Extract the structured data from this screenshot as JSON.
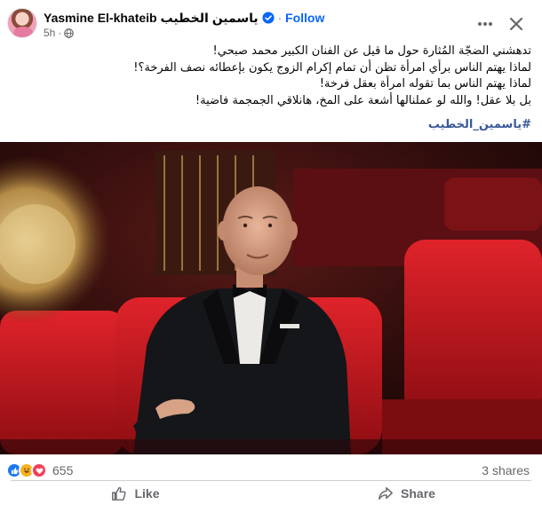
{
  "header": {
    "author_name": "Yasmine El-khateib ياسمين الخطيب",
    "separator": "·",
    "follow_label": "Follow",
    "time": "5h",
    "meta_separator": "·",
    "icons": {
      "verified": "verified-badge-icon",
      "audience": "globe-icon",
      "more": "more-options-icon",
      "close": "close-icon"
    }
  },
  "post": {
    "lines": [
      "تدهشني الضجّة المُثارة حول ما قيل عن الفنان الكبير محمد صبحي!",
      "لماذا يهتم الناس برأي امرأة تظن أن تمام إكرام الزوج يكون بإعطائه نصف الفرخة؟!",
      "لماذا يهتم الناس بما تقوله امرأة بعقل فرخة!",
      "بل بلا عقل! والله لو عملنالها أشعة على المخ، هانلاقي الجمجمة فاضية!"
    ],
    "hashtag": "#ياسمين_الخطيب"
  },
  "footer": {
    "reaction_count": "655",
    "shares": "3 shares",
    "like_label": "Like",
    "share_label": "Share",
    "reaction_icons": [
      "like-icon",
      "haha-icon",
      "love-icon"
    ]
  },
  "colors": {
    "accent": "#0866ff",
    "hashtag": "#385898",
    "secondary_text": "#65676b",
    "like": "#1877f2",
    "haha": "#f7b125",
    "love": "#f33e58"
  }
}
